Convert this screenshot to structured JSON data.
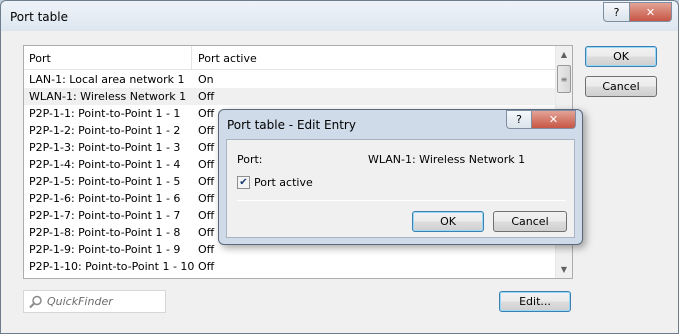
{
  "window": {
    "title": "Port table",
    "help_glyph": "?",
    "close_glyph": "✕"
  },
  "table": {
    "columns": [
      "Port",
      "Port active"
    ],
    "rows": [
      {
        "port": "LAN-1: Local area network 1",
        "active": "On"
      },
      {
        "port": "WLAN-1: Wireless Network 1",
        "active": "Off"
      },
      {
        "port": "P2P-1-1: Point-to-Point 1 - 1",
        "active": "Off"
      },
      {
        "port": "P2P-1-2: Point-to-Point 1 - 2",
        "active": "Off"
      },
      {
        "port": "P2P-1-3: Point-to-Point 1 - 3",
        "active": "Off"
      },
      {
        "port": "P2P-1-4: Point-to-Point 1 - 4",
        "active": "Off"
      },
      {
        "port": "P2P-1-5: Point-to-Point 1 - 5",
        "active": "Off"
      },
      {
        "port": "P2P-1-6: Point-to-Point 1 - 6",
        "active": "Off"
      },
      {
        "port": "P2P-1-7: Point-to-Point 1 - 7",
        "active": "Off"
      },
      {
        "port": "P2P-1-8: Point-to-Point 1 - 8",
        "active": "Off"
      },
      {
        "port": "P2P-1-9: Point-to-Point 1 - 9",
        "active": "Off"
      },
      {
        "port": "P2P-1-10: Point-to-Point 1 - 10",
        "active": "Off"
      }
    ]
  },
  "buttons": {
    "ok": "OK",
    "cancel": "Cancel",
    "edit": "Edit..."
  },
  "quickfinder": {
    "placeholder": "QuickFinder",
    "value": ""
  },
  "dialog": {
    "title": "Port table - Edit Entry",
    "help_glyph": "?",
    "close_glyph": "✕",
    "port_label": "Port:",
    "port_value": "WLAN-1: Wireless Network 1",
    "checkbox_label": "Port active",
    "checkbox_checked": true,
    "ok": "OK",
    "cancel": "Cancel"
  },
  "icons": {
    "search": "search-icon",
    "help": "help-icon",
    "close": "close-icon",
    "scroll_up": "arrow-up-icon",
    "scroll_down": "arrow-down-icon",
    "check": "checkmark-icon"
  },
  "colors": {
    "dialog_frame": "#cfdbe8",
    "close_button": "#c75645",
    "default_button_border": "#3c7fb1"
  }
}
